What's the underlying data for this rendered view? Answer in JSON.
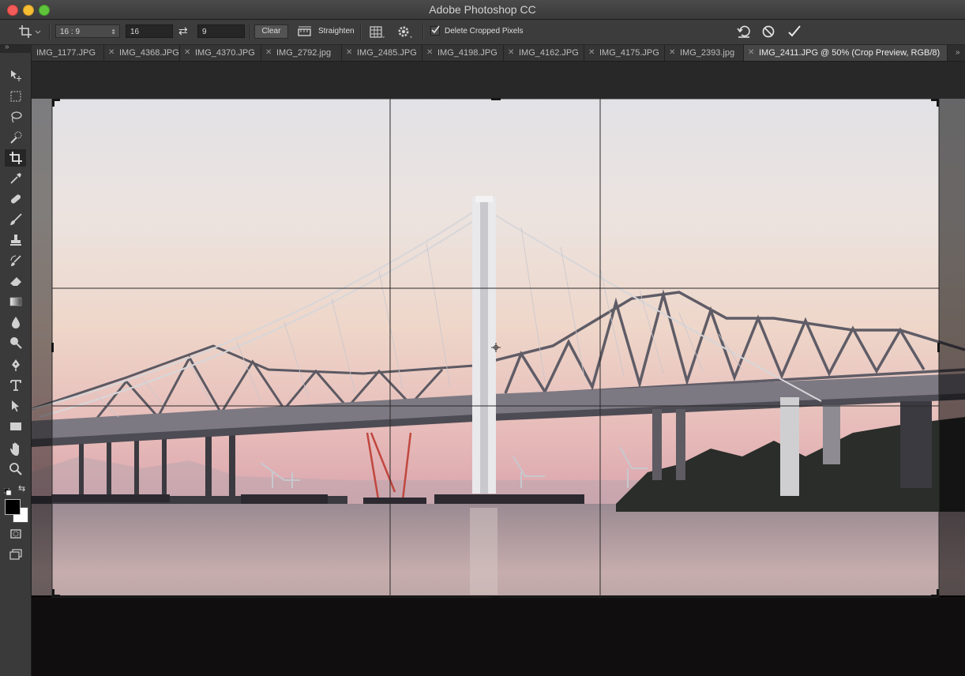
{
  "app": {
    "title": "Adobe Photoshop CC"
  },
  "options_bar": {
    "ratio_preset": "16 : 9",
    "width_value": "16",
    "height_value": "9",
    "clear_label": "Clear",
    "straighten_label": "Straighten",
    "delete_cropped_label": "Delete Cropped Pixels",
    "delete_cropped_checked": true
  },
  "tabs": [
    {
      "label": "IMG_1177.JPG",
      "active": false
    },
    {
      "label": "IMG_4368.JPG",
      "active": false
    },
    {
      "label": "IMG_4370.JPG",
      "active": false
    },
    {
      "label": "IMG_2792.jpg",
      "active": false
    },
    {
      "label": "IMG_2485.JPG",
      "active": false
    },
    {
      "label": "IMG_4198.JPG",
      "active": false
    },
    {
      "label": "IMG_4162.JPG",
      "active": false
    },
    {
      "label": "IMG_4175.JPG",
      "active": false
    },
    {
      "label": "IMG_2393.jpg",
      "active": false
    },
    {
      "label": "IMG_2411.JPG @ 50% (Crop Preview, RGB/8)",
      "active": true
    }
  ],
  "tools": [
    "move-tool-icon",
    "marquee-tool-icon",
    "lasso-tool-icon",
    "quick-selection-tool-icon",
    "crop-tool-icon",
    "eyedropper-tool-icon",
    "healing-brush-tool-icon",
    "brush-tool-icon",
    "clone-stamp-tool-icon",
    "history-brush-tool-icon",
    "eraser-tool-icon",
    "gradient-tool-icon",
    "blur-tool-icon",
    "dodge-tool-icon",
    "pen-tool-icon",
    "type-tool-icon",
    "path-selection-tool-icon",
    "rectangle-tool-icon",
    "hand-tool-icon",
    "zoom-tool-icon"
  ],
  "colors": {
    "foreground": "#000000",
    "background": "#ffffff"
  }
}
